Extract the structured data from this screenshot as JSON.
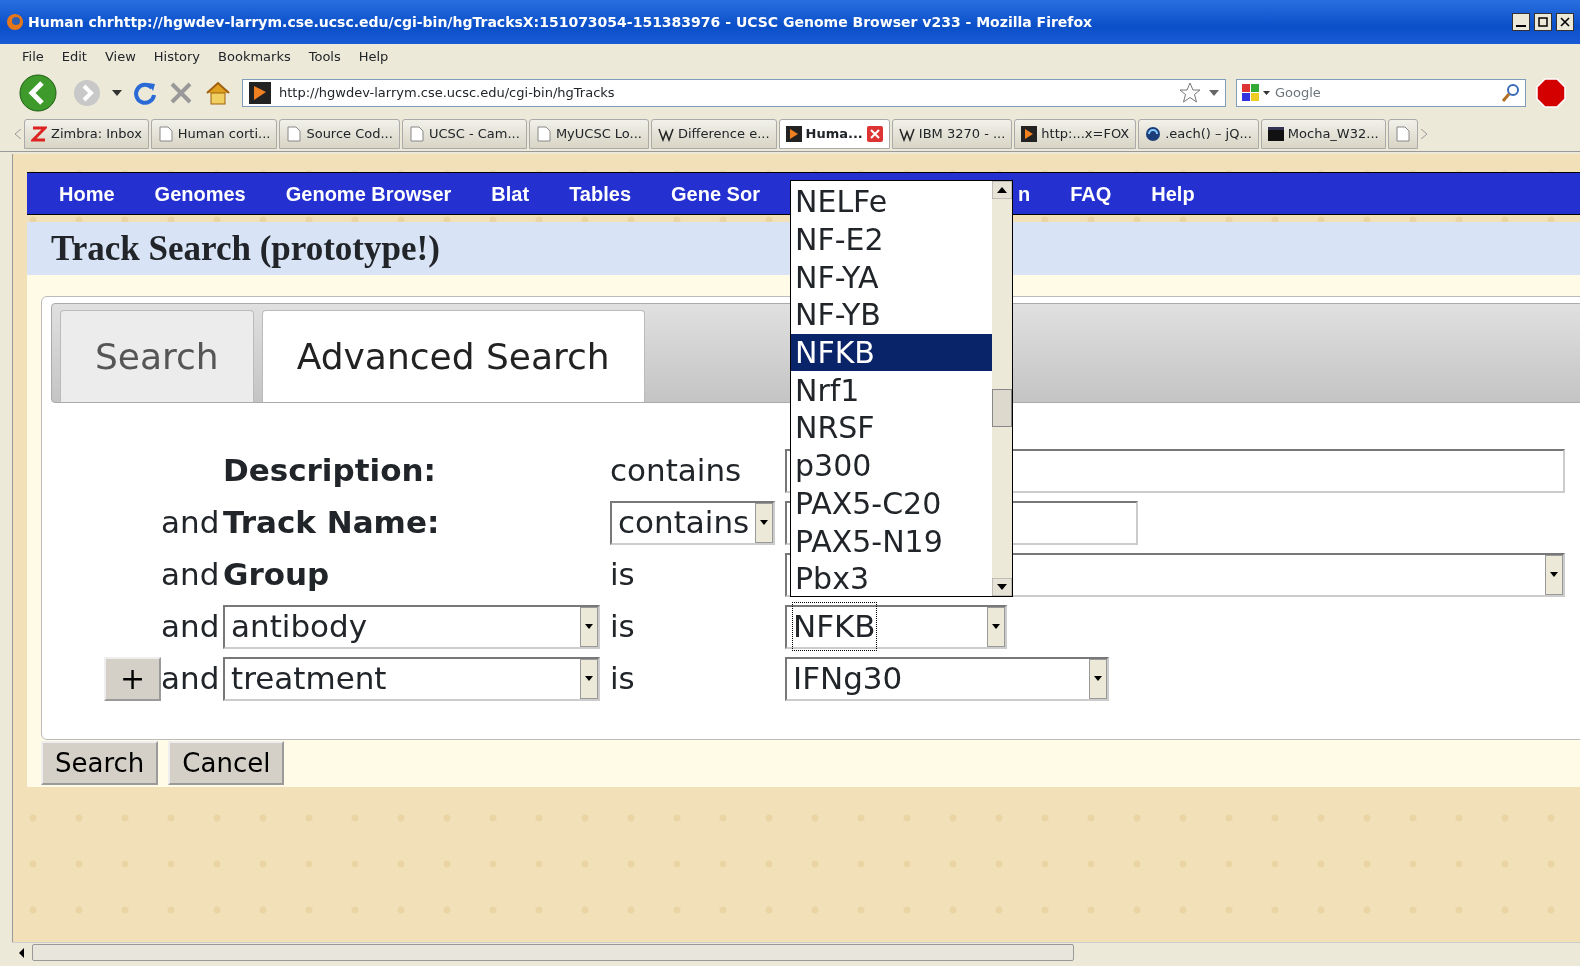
{
  "window": {
    "title": "Human chrhttp://hgwdev-larrym.cse.ucsc.edu/cgi-bin/hgTracksX:151073054-151383976 - UCSC Genome Browser v233 - Mozilla Firefox"
  },
  "menu": [
    "File",
    "Edit",
    "View",
    "History",
    "Bookmarks",
    "Tools",
    "Help"
  ],
  "toolbar": {
    "url": "http://hgwdev-larrym.cse.ucsc.edu/cgi-bin/hgTracks",
    "search_placeholder": "Google"
  },
  "browser_tabs": [
    {
      "label": "Zimbra: Inbox",
      "kind": "mail",
      "selected": false
    },
    {
      "label": "Human corti...",
      "kind": "page",
      "selected": false
    },
    {
      "label": "Source Cod...",
      "kind": "page",
      "selected": false
    },
    {
      "label": "UCSC - Cam...",
      "kind": "page",
      "selected": false
    },
    {
      "label": "MyUCSC Lo...",
      "kind": "page",
      "selected": false
    },
    {
      "label": "Difference e...",
      "kind": "wiki",
      "selected": false
    },
    {
      "label": "Huma...",
      "kind": "genome",
      "selected": true
    },
    {
      "label": "IBM 3270 - ...",
      "kind": "wiki",
      "selected": false
    },
    {
      "label": "http:...x=FOX",
      "kind": "genome",
      "selected": false
    },
    {
      "label": ".each() – jQ...",
      "kind": "swirl",
      "selected": false
    },
    {
      "label": "Mocha_W32...",
      "kind": "terminal",
      "selected": false
    }
  ],
  "site_nav": [
    "Home",
    "Genomes",
    "Genome Browser",
    "Blat",
    "Tables",
    "Gene Sor",
    "n",
    "FAQ",
    "Help"
  ],
  "page_title": "Track Search (prototype!)",
  "tabs": [
    {
      "label": "Search",
      "selected": false
    },
    {
      "label": "Advanced Search",
      "selected": true
    }
  ],
  "rows": [
    {
      "field": {
        "kind": "label",
        "text": "Description:"
      },
      "operator": {
        "kind": "text",
        "text": "contains"
      },
      "value": {
        "kind": "input"
      }
    },
    {
      "prefix": "and",
      "field": {
        "kind": "label",
        "text": "Track Name:"
      },
      "operator": {
        "kind": "select",
        "text": "contains"
      },
      "value": {
        "kind": "input"
      }
    },
    {
      "prefix": "and",
      "field": {
        "kind": "label",
        "text": "Group"
      },
      "operator": {
        "kind": "text",
        "text": "is"
      },
      "value": {
        "kind": "select"
      }
    },
    {
      "prefix": "and",
      "field": {
        "kind": "select",
        "text": "antibody"
      },
      "operator": {
        "kind": "text",
        "text": "is"
      },
      "value": {
        "kind": "select",
        "text": "NFKB",
        "focused": true
      }
    },
    {
      "add_button": "+",
      "prefix": "and",
      "field": {
        "kind": "select",
        "text": "treatment"
      },
      "operator": {
        "kind": "text",
        "text": "is"
      },
      "value": {
        "kind": "select",
        "text": "IFNg30"
      }
    }
  ],
  "dropdown": {
    "options": [
      {
        "label": "NELFe",
        "selected": false
      },
      {
        "label": "NF-E2",
        "selected": false
      },
      {
        "label": "NF-YA",
        "selected": false
      },
      {
        "label": "NF-YB",
        "selected": false
      },
      {
        "label": "NFKB",
        "selected": true
      },
      {
        "label": "Nrf1",
        "selected": false
      },
      {
        "label": "NRSF",
        "selected": false
      },
      {
        "label": "p300",
        "selected": false
      },
      {
        "label": "PAX5-C20",
        "selected": false
      },
      {
        "label": "PAX5-N19",
        "selected": false
      },
      {
        "label": "Pbx3",
        "selected": false
      }
    ]
  },
  "buttons": [
    "Search",
    "Cancel"
  ]
}
